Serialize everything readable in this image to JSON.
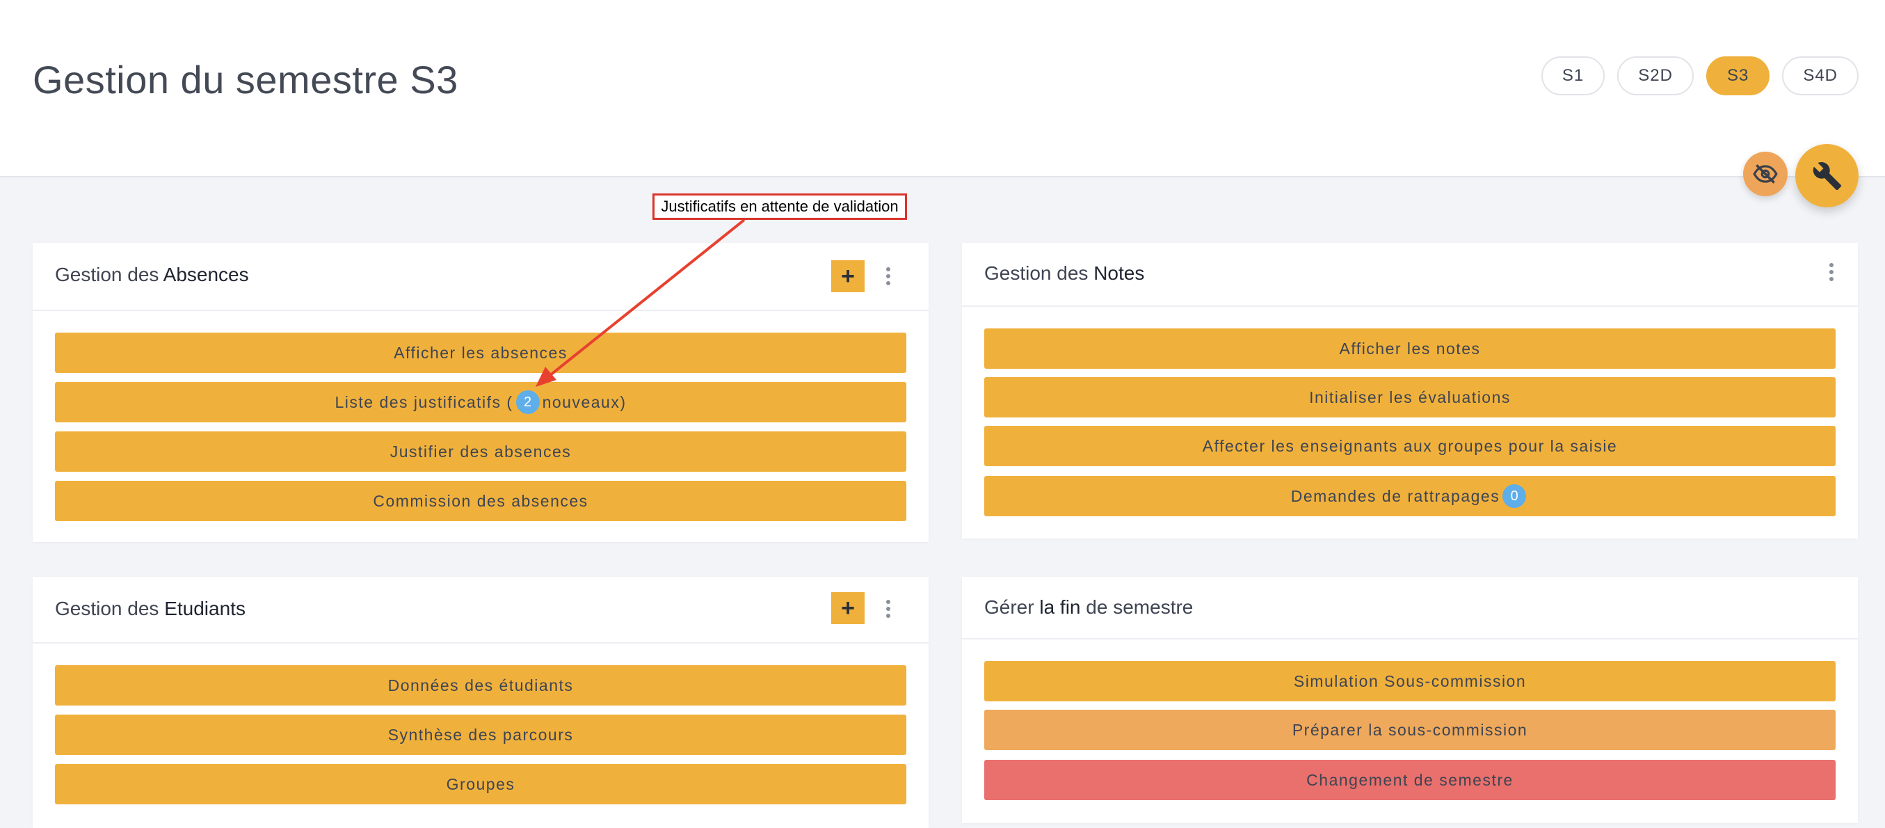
{
  "header": {
    "title": "Gestion du semestre S3",
    "semesters": [
      {
        "label": "S1",
        "active": false
      },
      {
        "label": "S2D",
        "active": false
      },
      {
        "label": "S3",
        "active": true
      },
      {
        "label": "S4D",
        "active": false
      }
    ]
  },
  "fabs": {
    "small_icon": "eye-off-icon",
    "large_icon": "wrench-icon"
  },
  "annotation": {
    "label": "Justificatifs en attente de validation"
  },
  "cards": {
    "absences": {
      "title_prefix": "Gestion des",
      "title_bold": "Absences",
      "plus_label": "+",
      "actions": {
        "show": "Afficher les absences",
        "justif_prefix": "Liste des justificatifs (",
        "justif_count": "2",
        "justif_suffix": " nouveaux)",
        "justify": "Justifier des absences",
        "commission": "Commission des absences"
      }
    },
    "notes": {
      "title_prefix": "Gestion des",
      "title_bold": "Notes",
      "actions": {
        "show": "Afficher les notes",
        "init": "Initialiser les évaluations",
        "assign": "Affecter les enseignants aux groupes pour la saisie",
        "rattrapage": "Demandes de rattrapages",
        "rattrapage_count": "0"
      }
    },
    "etudiants": {
      "title_prefix": "Gestion des",
      "title_bold": "Etudiants",
      "plus_label": "+",
      "actions": {
        "data": "Données des étudiants",
        "synthese": "Synthèse des parcours",
        "groupes": "Groupes"
      }
    },
    "fin": {
      "title_prefix": "Gérer",
      "title_bold": "la fin",
      "title_suffix": "de semestre",
      "actions": {
        "simulation": "Simulation Sous-commission",
        "preparer": "Préparer la sous-commission",
        "changement": "Changement de semestre"
      }
    }
  },
  "colors": {
    "accent": "#f0b13c",
    "orange": "#efa95c",
    "danger": "#e9706c",
    "badge": "#5eaeea",
    "annotation": "#d9342b"
  }
}
